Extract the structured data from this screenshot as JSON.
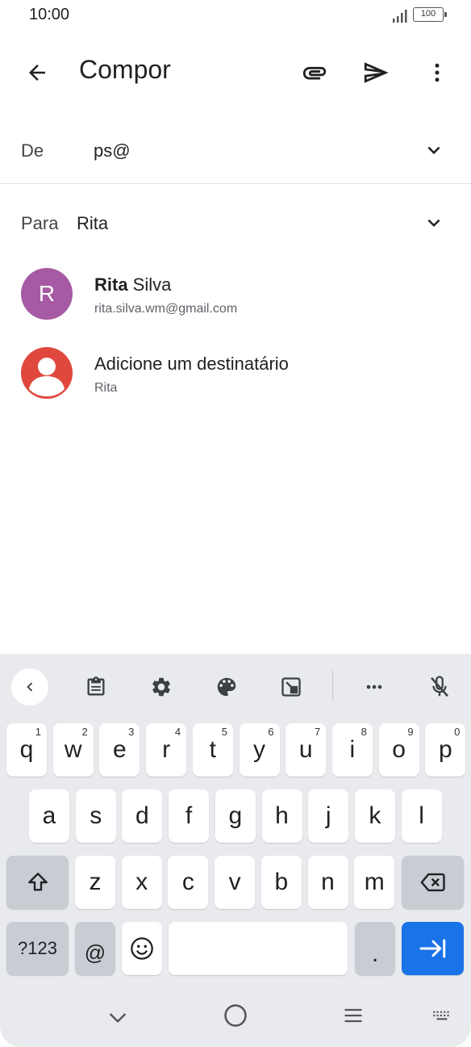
{
  "status": {
    "time": "10:00",
    "battery": "100"
  },
  "app_bar": {
    "title": "Compor"
  },
  "from": {
    "label": "De",
    "value": "ps@"
  },
  "to": {
    "label": "Para",
    "value": "Rita"
  },
  "suggestions": [
    {
      "initial": "R",
      "name_bold": "Rita",
      "name_rest": " Silva",
      "subtitle": "rita.silva.wm@gmail.com"
    },
    {
      "name": "Adicione um destinatário",
      "subtitle": "Rita"
    }
  ],
  "keyboard": {
    "row1": [
      {
        "label": "q",
        "hint": "1"
      },
      {
        "label": "w",
        "hint": "2"
      },
      {
        "label": "e",
        "hint": "3"
      },
      {
        "label": "r",
        "hint": "4"
      },
      {
        "label": "t",
        "hint": "5"
      },
      {
        "label": "y",
        "hint": "6"
      },
      {
        "label": "u",
        "hint": "7"
      },
      {
        "label": "i",
        "hint": "8"
      },
      {
        "label": "o",
        "hint": "9"
      },
      {
        "label": "p",
        "hint": "0"
      }
    ],
    "row2": [
      "a",
      "s",
      "d",
      "f",
      "g",
      "h",
      "j",
      "k",
      "l"
    ],
    "row3": [
      "z",
      "x",
      "c",
      "v",
      "b",
      "n",
      "m"
    ],
    "symbols_label": "?123",
    "at_label": "@",
    "period_label": "."
  },
  "colors": {
    "accent": "#1a73e8",
    "avatar_r": "#a55aa3",
    "avatar_person": "#e0483d"
  }
}
